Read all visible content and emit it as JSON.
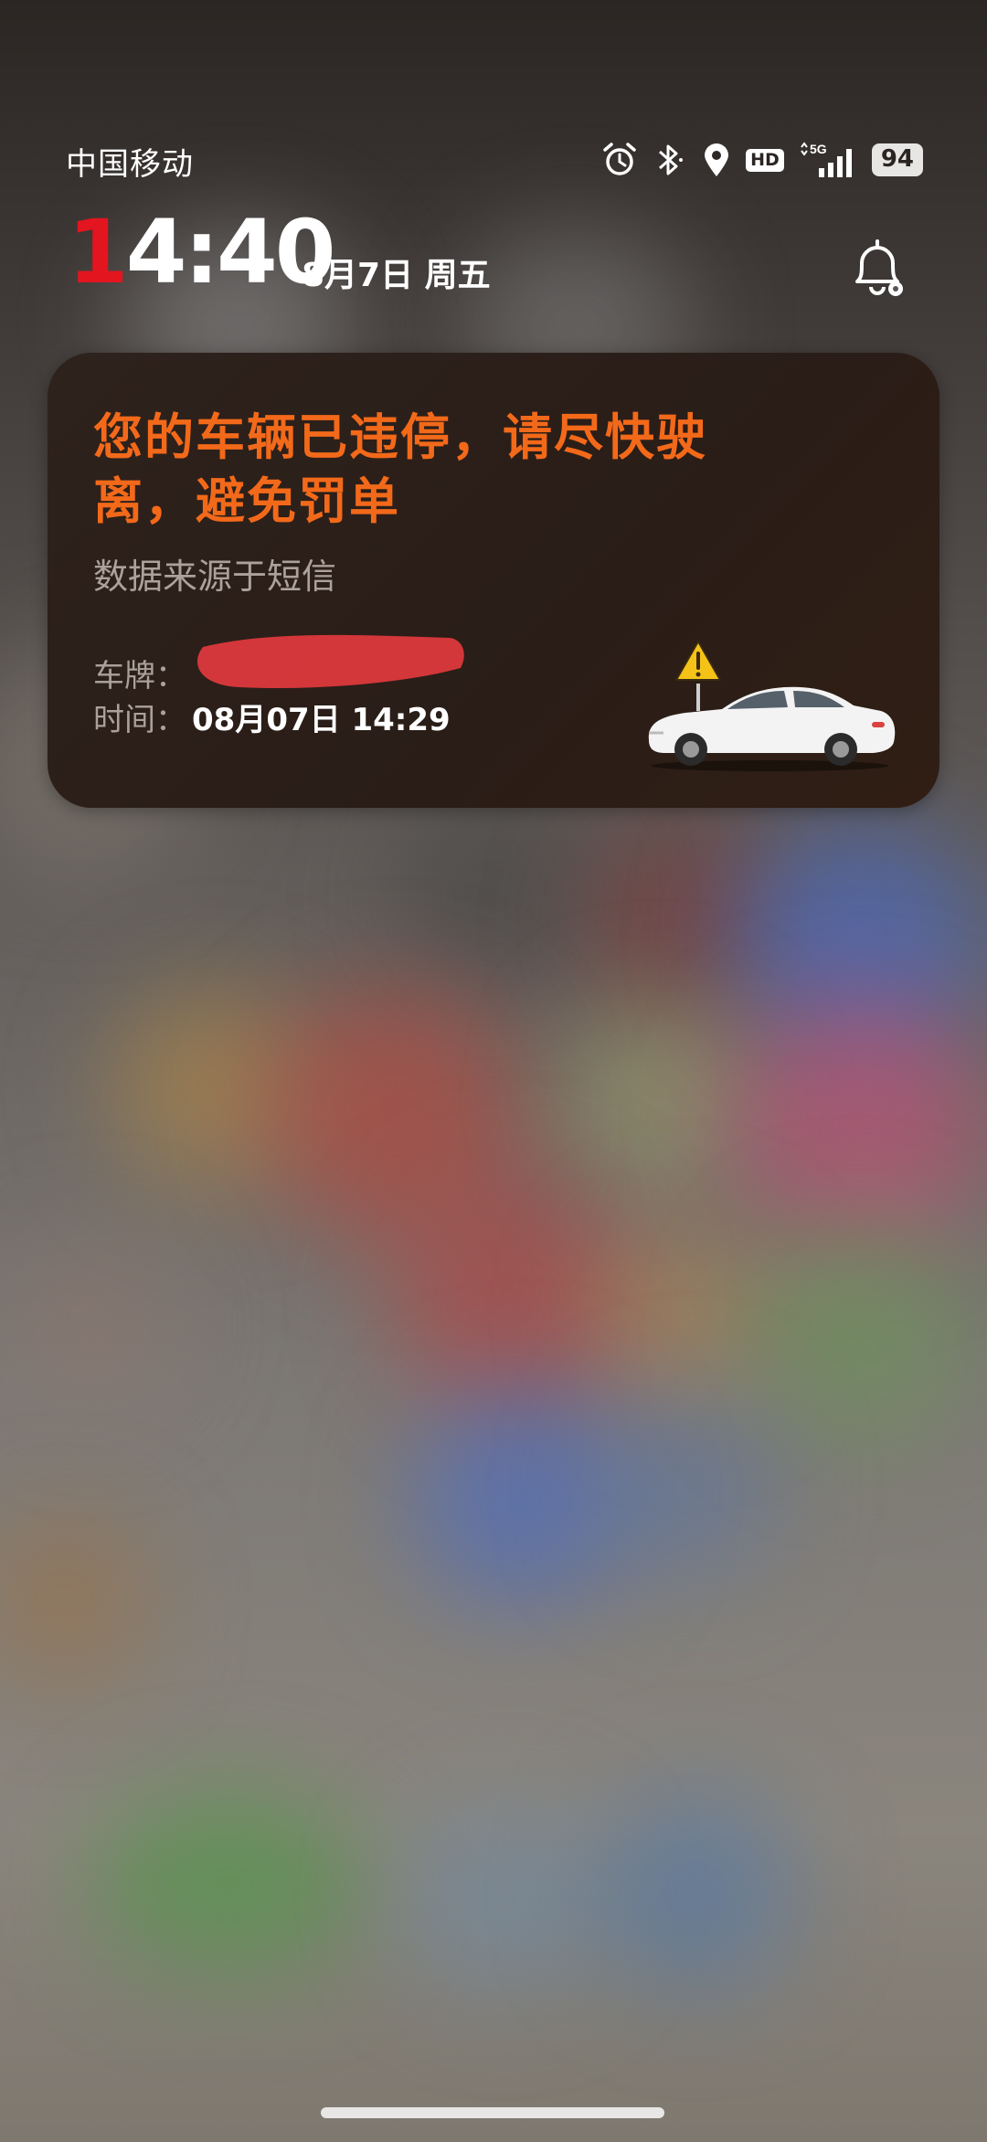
{
  "status_bar": {
    "carrier": "中国移动",
    "network": "5G",
    "hd_label": "HD",
    "battery": "94",
    "icons": [
      "alarm-icon",
      "bluetooth-icon",
      "location-icon",
      "hd-icon",
      "signal-5g-icon",
      "battery-icon"
    ]
  },
  "clock": {
    "time_first_digit": "1",
    "time_rest": "4:40",
    "date": "8月7日 周五"
  },
  "notification": {
    "title": "您的车辆已违停，请尽快驶离，避免罚单",
    "source": "数据来源于短信",
    "plate_label": "车牌：",
    "time_label": "时间：",
    "time_value": "08月07日 14:29",
    "accent_color": "#f3691a"
  },
  "colors": {
    "clock_accent": "#e3151f"
  }
}
